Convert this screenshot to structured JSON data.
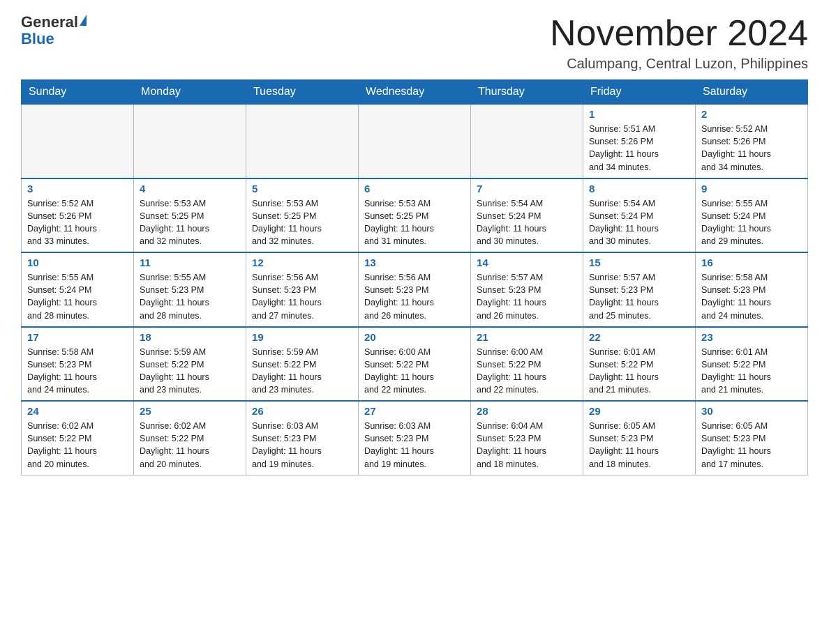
{
  "logo": {
    "general": "General",
    "blue": "Blue"
  },
  "header": {
    "month_title": "November 2024",
    "location": "Calumpang, Central Luzon, Philippines"
  },
  "days_of_week": [
    "Sunday",
    "Monday",
    "Tuesday",
    "Wednesday",
    "Thursday",
    "Friday",
    "Saturday"
  ],
  "weeks": [
    [
      {
        "day": "",
        "info": ""
      },
      {
        "day": "",
        "info": ""
      },
      {
        "day": "",
        "info": ""
      },
      {
        "day": "",
        "info": ""
      },
      {
        "day": "",
        "info": ""
      },
      {
        "day": "1",
        "info": "Sunrise: 5:51 AM\nSunset: 5:26 PM\nDaylight: 11 hours\nand 34 minutes."
      },
      {
        "day": "2",
        "info": "Sunrise: 5:52 AM\nSunset: 5:26 PM\nDaylight: 11 hours\nand 34 minutes."
      }
    ],
    [
      {
        "day": "3",
        "info": "Sunrise: 5:52 AM\nSunset: 5:26 PM\nDaylight: 11 hours\nand 33 minutes."
      },
      {
        "day": "4",
        "info": "Sunrise: 5:53 AM\nSunset: 5:25 PM\nDaylight: 11 hours\nand 32 minutes."
      },
      {
        "day": "5",
        "info": "Sunrise: 5:53 AM\nSunset: 5:25 PM\nDaylight: 11 hours\nand 32 minutes."
      },
      {
        "day": "6",
        "info": "Sunrise: 5:53 AM\nSunset: 5:25 PM\nDaylight: 11 hours\nand 31 minutes."
      },
      {
        "day": "7",
        "info": "Sunrise: 5:54 AM\nSunset: 5:24 PM\nDaylight: 11 hours\nand 30 minutes."
      },
      {
        "day": "8",
        "info": "Sunrise: 5:54 AM\nSunset: 5:24 PM\nDaylight: 11 hours\nand 30 minutes."
      },
      {
        "day": "9",
        "info": "Sunrise: 5:55 AM\nSunset: 5:24 PM\nDaylight: 11 hours\nand 29 minutes."
      }
    ],
    [
      {
        "day": "10",
        "info": "Sunrise: 5:55 AM\nSunset: 5:24 PM\nDaylight: 11 hours\nand 28 minutes."
      },
      {
        "day": "11",
        "info": "Sunrise: 5:55 AM\nSunset: 5:23 PM\nDaylight: 11 hours\nand 28 minutes."
      },
      {
        "day": "12",
        "info": "Sunrise: 5:56 AM\nSunset: 5:23 PM\nDaylight: 11 hours\nand 27 minutes."
      },
      {
        "day": "13",
        "info": "Sunrise: 5:56 AM\nSunset: 5:23 PM\nDaylight: 11 hours\nand 26 minutes."
      },
      {
        "day": "14",
        "info": "Sunrise: 5:57 AM\nSunset: 5:23 PM\nDaylight: 11 hours\nand 26 minutes."
      },
      {
        "day": "15",
        "info": "Sunrise: 5:57 AM\nSunset: 5:23 PM\nDaylight: 11 hours\nand 25 minutes."
      },
      {
        "day": "16",
        "info": "Sunrise: 5:58 AM\nSunset: 5:23 PM\nDaylight: 11 hours\nand 24 minutes."
      }
    ],
    [
      {
        "day": "17",
        "info": "Sunrise: 5:58 AM\nSunset: 5:23 PM\nDaylight: 11 hours\nand 24 minutes."
      },
      {
        "day": "18",
        "info": "Sunrise: 5:59 AM\nSunset: 5:22 PM\nDaylight: 11 hours\nand 23 minutes."
      },
      {
        "day": "19",
        "info": "Sunrise: 5:59 AM\nSunset: 5:22 PM\nDaylight: 11 hours\nand 23 minutes."
      },
      {
        "day": "20",
        "info": "Sunrise: 6:00 AM\nSunset: 5:22 PM\nDaylight: 11 hours\nand 22 minutes."
      },
      {
        "day": "21",
        "info": "Sunrise: 6:00 AM\nSunset: 5:22 PM\nDaylight: 11 hours\nand 22 minutes."
      },
      {
        "day": "22",
        "info": "Sunrise: 6:01 AM\nSunset: 5:22 PM\nDaylight: 11 hours\nand 21 minutes."
      },
      {
        "day": "23",
        "info": "Sunrise: 6:01 AM\nSunset: 5:22 PM\nDaylight: 11 hours\nand 21 minutes."
      }
    ],
    [
      {
        "day": "24",
        "info": "Sunrise: 6:02 AM\nSunset: 5:22 PM\nDaylight: 11 hours\nand 20 minutes."
      },
      {
        "day": "25",
        "info": "Sunrise: 6:02 AM\nSunset: 5:22 PM\nDaylight: 11 hours\nand 20 minutes."
      },
      {
        "day": "26",
        "info": "Sunrise: 6:03 AM\nSunset: 5:23 PM\nDaylight: 11 hours\nand 19 minutes."
      },
      {
        "day": "27",
        "info": "Sunrise: 6:03 AM\nSunset: 5:23 PM\nDaylight: 11 hours\nand 19 minutes."
      },
      {
        "day": "28",
        "info": "Sunrise: 6:04 AM\nSunset: 5:23 PM\nDaylight: 11 hours\nand 18 minutes."
      },
      {
        "day": "29",
        "info": "Sunrise: 6:05 AM\nSunset: 5:23 PM\nDaylight: 11 hours\nand 18 minutes."
      },
      {
        "day": "30",
        "info": "Sunrise: 6:05 AM\nSunset: 5:23 PM\nDaylight: 11 hours\nand 17 minutes."
      }
    ]
  ]
}
